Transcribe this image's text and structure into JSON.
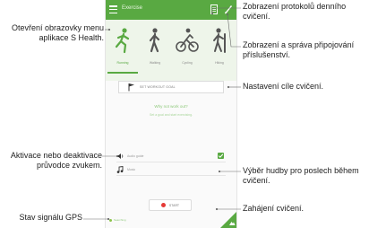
{
  "app": {
    "title": "Exercise",
    "exercise_types": [
      {
        "label": "Running",
        "active": true
      },
      {
        "label": "Walking",
        "active": false
      },
      {
        "label": "Cycling",
        "active": false
      },
      {
        "label": "Hiking",
        "active": false
      }
    ],
    "goal_label": "SET WORKOUT GOAL",
    "question": "Why not work out?",
    "hint": "Set a goal and start exercising.",
    "audio_guide_label": "Audio guide",
    "audio_guide_checked": true,
    "music_label": "Music",
    "start_label": "START",
    "gps_label": "Searching",
    "accent_color": "#59a942"
  },
  "callouts": {
    "menu": "Otevření obrazovky menu aplikace S Health.",
    "logs": "Zobrazení protokolů denního cvičení.",
    "accessories": "Zobrazení a správa připojování příslušenství.",
    "goal": "Nastavení cíle cvičení.",
    "audio": "Aktivace nebo deaktivace průvodce zvukem.",
    "music": "Výběr hudby pro poslech během cvičení.",
    "start": "Zahájení cvičení.",
    "gps": "Stav signálu GPS"
  }
}
